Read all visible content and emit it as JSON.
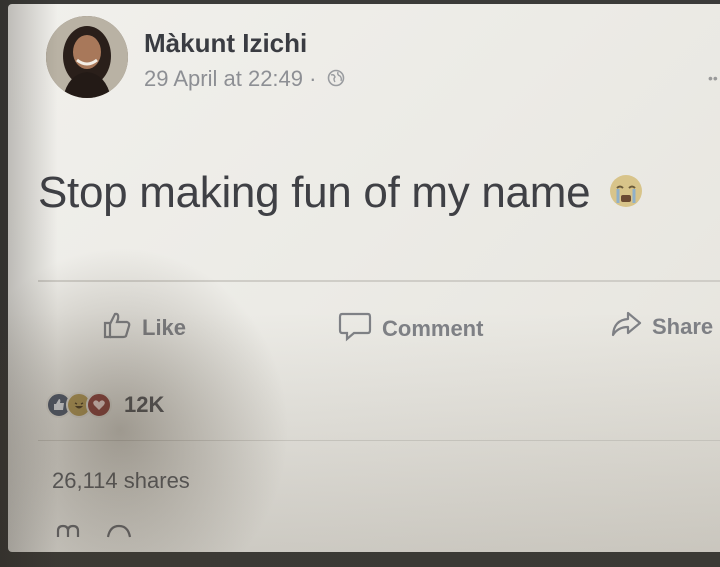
{
  "post": {
    "author_name": "Màkunt Izichi",
    "timestamp": "29 April at 22:49 ·",
    "privacy_icon": "globe-icon",
    "text": "Stop making fun of my name",
    "emoji_icon": "crying-face-icon"
  },
  "actions": {
    "like_label": "Like",
    "comment_label": "Comment",
    "share_label": "Share"
  },
  "stats": {
    "reaction_icons": [
      "like-reaction-icon",
      "haha-reaction-icon",
      "love-reaction-icon"
    ],
    "reactions_count": "12K",
    "shares": "26,114 shares"
  },
  "colors": {
    "card_background": "#eeede8",
    "text": "#3f4045",
    "muted_text": "#8d8f94"
  }
}
